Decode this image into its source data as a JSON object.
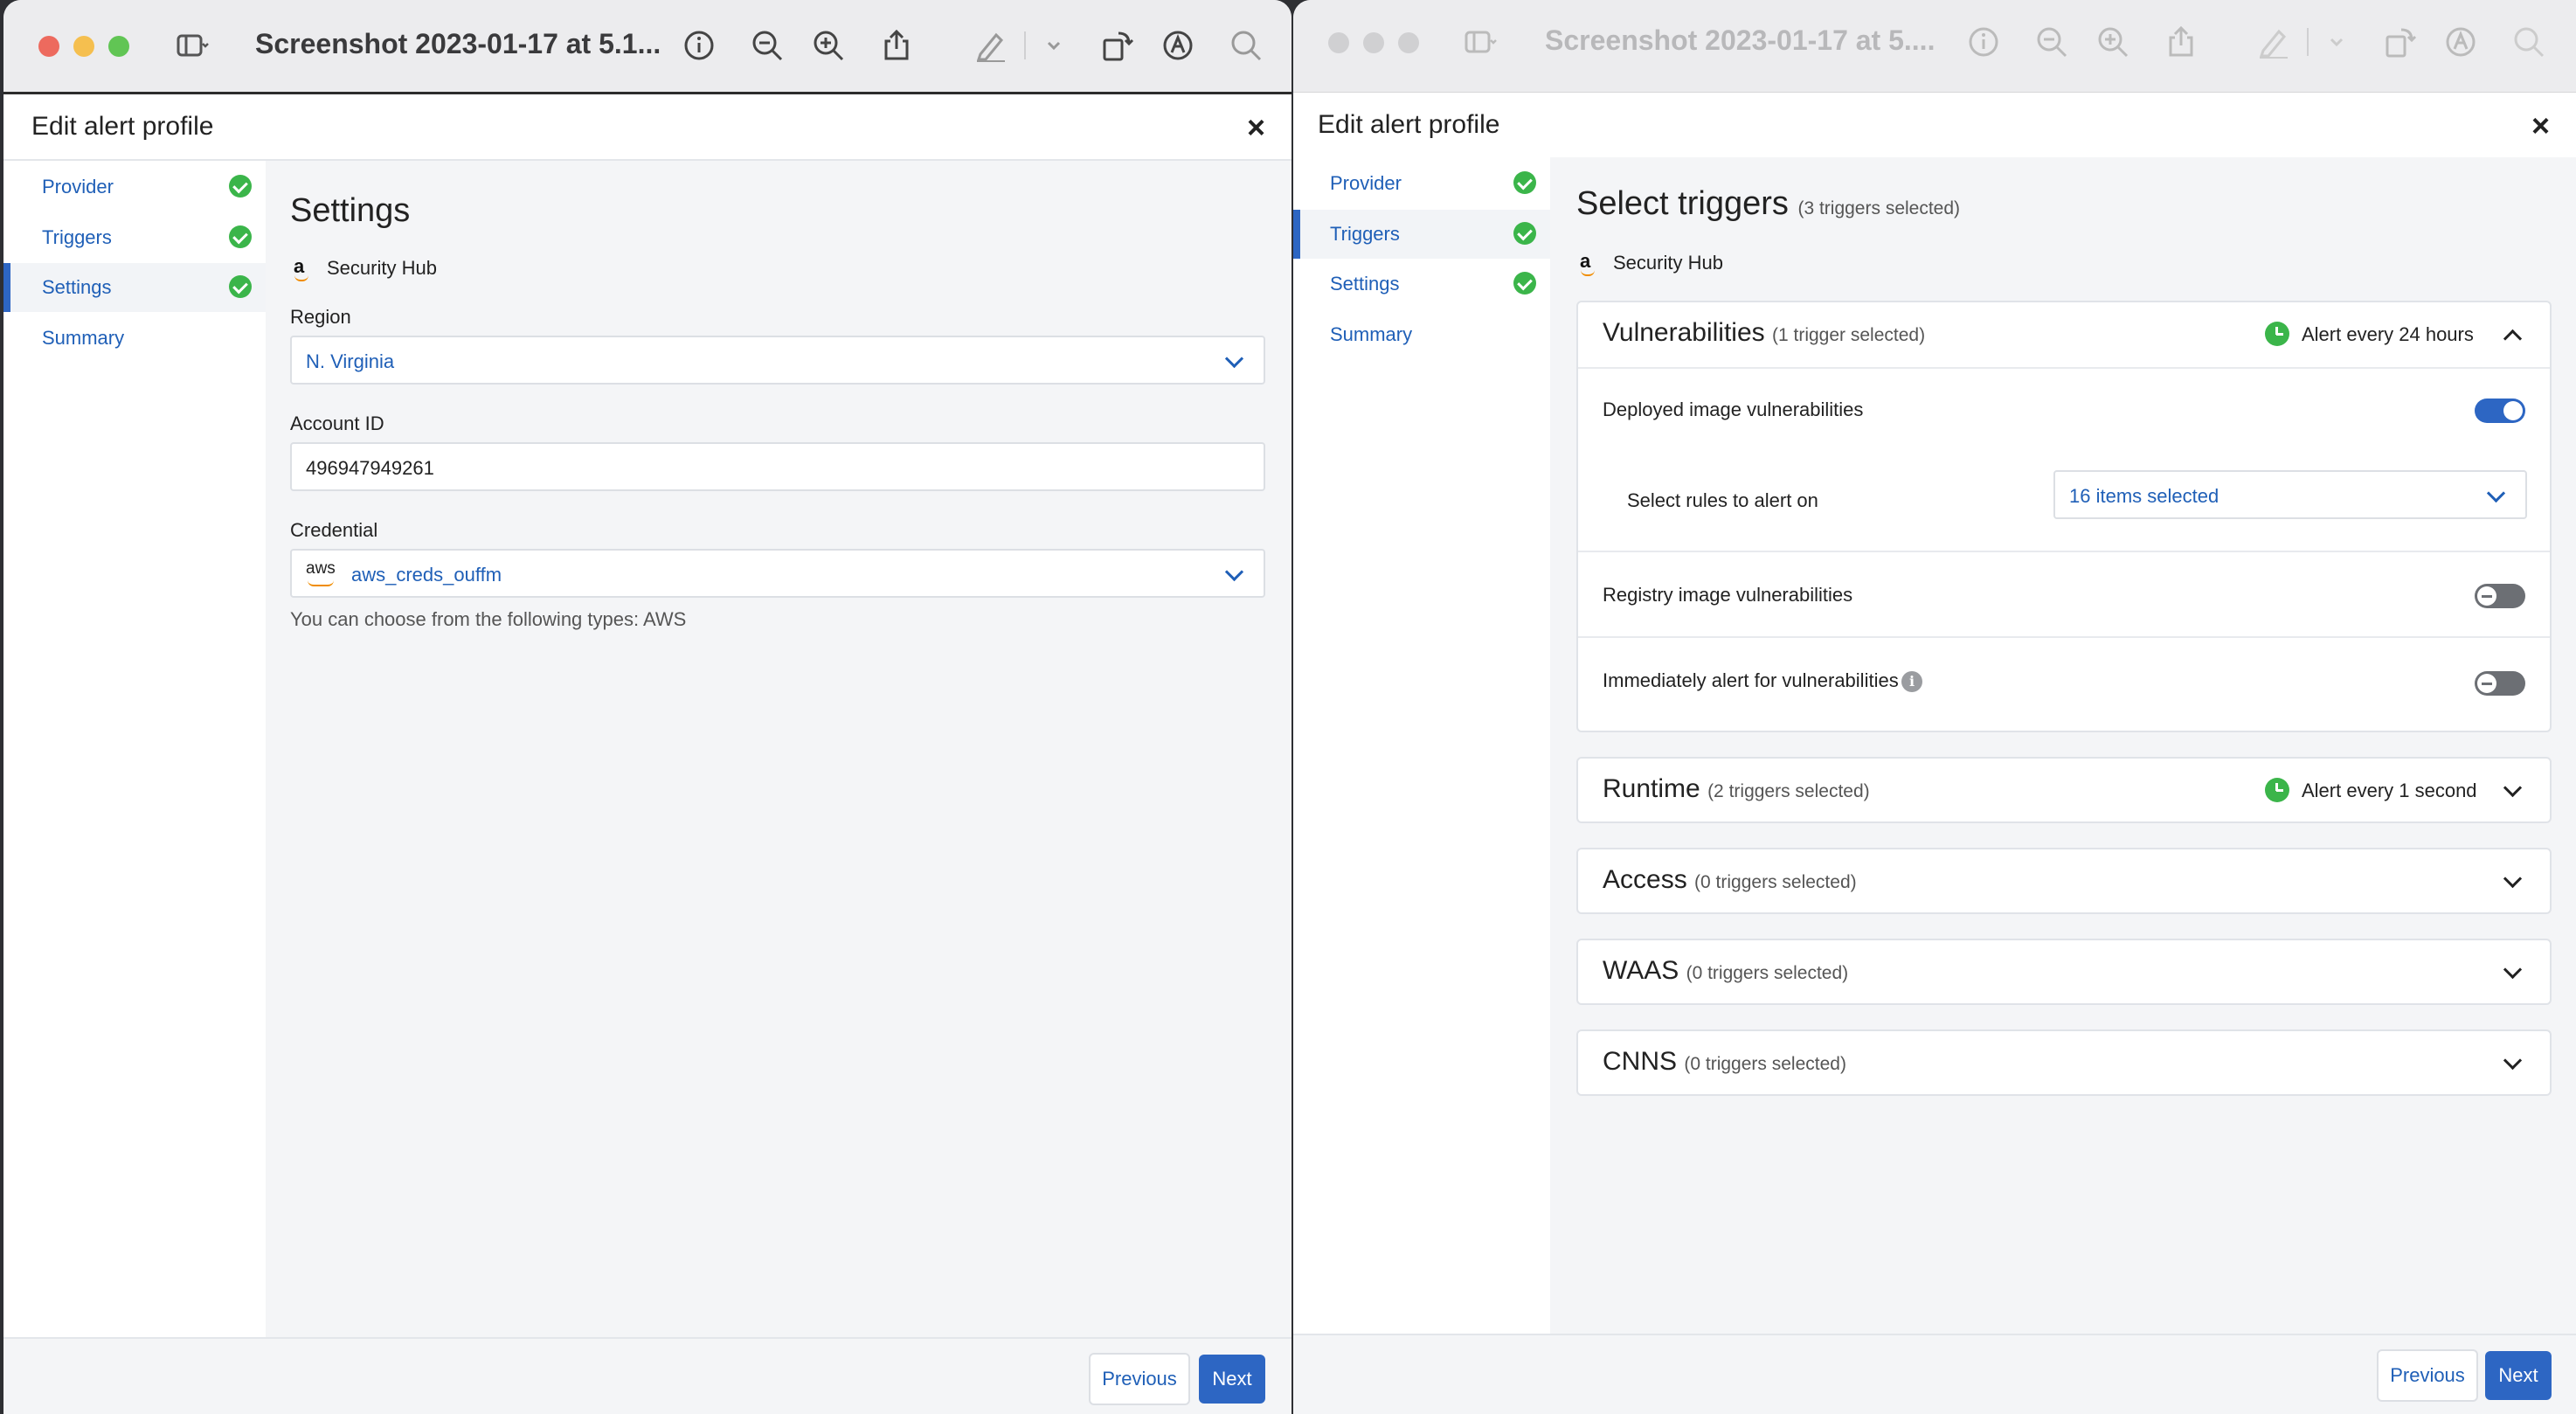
{
  "left_window": {
    "doc_title": "Screenshot 2023-01-17 at 5.1...",
    "modal": {
      "title": "Edit alert profile",
      "close": "×",
      "sidebar": [
        {
          "label": "Provider",
          "complete": true
        },
        {
          "label": "Triggers",
          "complete": true
        },
        {
          "label": "Settings",
          "complete": true,
          "active": true
        },
        {
          "label": "Summary",
          "complete": false
        }
      ],
      "heading": "Settings",
      "provider_logo": "a",
      "provider_name": "Security Hub",
      "region_label": "Region",
      "region_value": "N. Virginia",
      "account_label": "Account ID",
      "account_value": "496947949261",
      "credential_label": "Credential",
      "credential_logo": "aws",
      "credential_value": "aws_creds_ouffm",
      "credential_hint": "You can choose from the following types: AWS",
      "prev_label": "Previous",
      "next_label": "Next"
    }
  },
  "right_window": {
    "doc_title": "Screenshot 2023-01-17 at 5....",
    "modal": {
      "title": "Edit alert profile",
      "close": "×",
      "sidebar": [
        {
          "label": "Provider",
          "complete": true
        },
        {
          "label": "Triggers",
          "complete": true,
          "active": true
        },
        {
          "label": "Settings",
          "complete": true
        },
        {
          "label": "Summary",
          "complete": false
        }
      ],
      "heading": "Select triggers",
      "heading_count": "(3 triggers selected)",
      "provider_logo": "a",
      "provider_name": "Security Hub",
      "sections": {
        "vulnerabilities": {
          "title": "Vulnerabilities",
          "count": "(1 trigger selected)",
          "frequency": "Alert every 24 hours",
          "deployed_label": "Deployed image vulnerabilities",
          "deployed_on": true,
          "rules_label": "Select rules to alert on",
          "rules_value": "16 items selected",
          "registry_label": "Registry image vulnerabilities",
          "registry_on": false,
          "immediate_label": "Immediately alert for vulnerabilities",
          "immediate_on": false,
          "info_glyph": "i"
        },
        "runtime": {
          "title": "Runtime",
          "count": "(2 triggers selected)",
          "frequency": "Alert every 1 second"
        },
        "access": {
          "title": "Access",
          "count": "(0 triggers selected)"
        },
        "waas": {
          "title": "WAAS",
          "count": "(0 triggers selected)"
        },
        "cnns": {
          "title": "CNNS",
          "count": "(0 triggers selected)"
        }
      },
      "prev_label": "Previous",
      "next_label": "Next"
    }
  },
  "colors": {
    "accent": "#2d66c3",
    "link": "#1f5fb7",
    "success": "#3bb54a"
  },
  "icons": [
    "sidebar-toggle-icon",
    "info-icon",
    "zoom-out-icon",
    "zoom-in-icon",
    "share-icon",
    "markup-pen-icon",
    "rotate-icon",
    "markup-circle-icon",
    "search-icon"
  ]
}
